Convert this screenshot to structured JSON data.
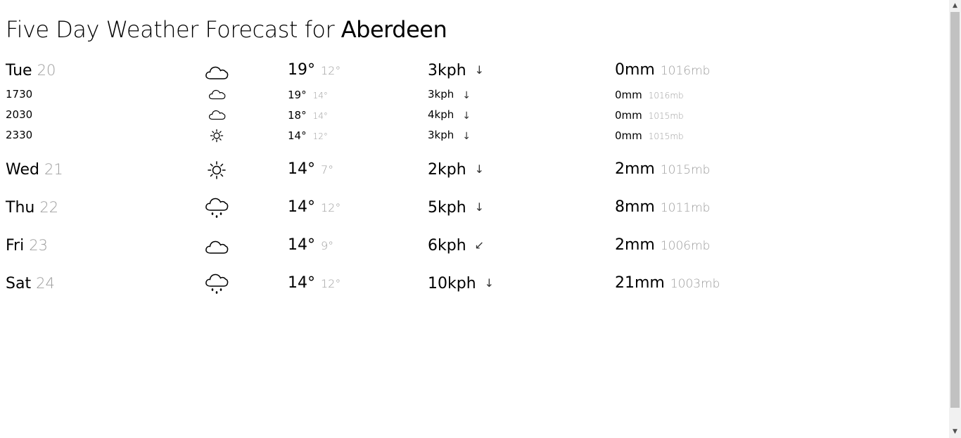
{
  "title": {
    "prefix": "Five Day Weather Forecast for",
    "city": "Aberdeen"
  },
  "days": [
    {
      "day": "Tue",
      "date": "20",
      "icon": "cloud-icon",
      "high": "19°",
      "low": "12°",
      "wind": "3kph",
      "wind_arrow": "↓",
      "rain": "0mm",
      "pressure": "1016mb",
      "hours": [
        {
          "time": "1730",
          "icon": "cloud-icon",
          "high": "19°",
          "low": "14°",
          "wind": "3kph",
          "wind_arrow": "↓",
          "rain": "0mm",
          "pressure": "1016mb"
        },
        {
          "time": "2030",
          "icon": "cloud-icon",
          "high": "18°",
          "low": "14°",
          "wind": "4kph",
          "wind_arrow": "↓",
          "rain": "0mm",
          "pressure": "1015mb"
        },
        {
          "time": "2330",
          "icon": "sun-icon",
          "high": "14°",
          "low": "12°",
          "wind": "3kph",
          "wind_arrow": "↓",
          "rain": "0mm",
          "pressure": "1015mb"
        }
      ]
    },
    {
      "day": "Wed",
      "date": "21",
      "icon": "sun-icon",
      "high": "14°",
      "low": "7°",
      "wind": "2kph",
      "wind_arrow": "↓",
      "rain": "2mm",
      "pressure": "1015mb"
    },
    {
      "day": "Thu",
      "date": "22",
      "icon": "rain-cloud-icon",
      "high": "14°",
      "low": "12°",
      "wind": "5kph",
      "wind_arrow": "↓",
      "rain": "8mm",
      "pressure": "1011mb"
    },
    {
      "day": "Fri",
      "date": "23",
      "icon": "cloud-icon",
      "high": "14°",
      "low": "9°",
      "wind": "6kph",
      "wind_arrow": "↙",
      "rain": "2mm",
      "pressure": "1006mb"
    },
    {
      "day": "Sat",
      "date": "24",
      "icon": "rain-cloud-icon",
      "high": "14°",
      "low": "12°",
      "wind": "10kph",
      "wind_arrow": "↓",
      "rain": "21mm",
      "pressure": "1003mb"
    }
  ],
  "scrollbar": {
    "up": "▲",
    "down": "▼"
  }
}
